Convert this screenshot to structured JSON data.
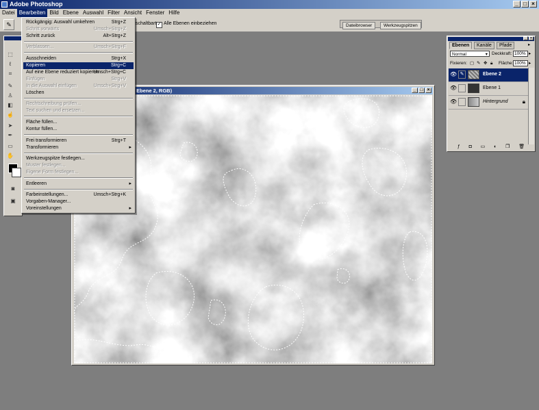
{
  "app": {
    "title": "Adobe Photoshop"
  },
  "menubar": [
    "Datei",
    "Bearbeiten",
    "Bild",
    "Ebene",
    "Auswahl",
    "Filter",
    "Ansicht",
    "Fenster",
    "Hilfe"
  ],
  "options_bar": {
    "partial_text": "schaltbart",
    "all_layers_label": "Alle Ebenen einbeziehen",
    "palette_tabs": [
      "Dateibrowser",
      "Werkzeugspitzen"
    ]
  },
  "edit_menu": [
    {
      "label": "Rückgängig: Auswahl umkehren",
      "shortcut": "Strg+Z",
      "state": "enabled"
    },
    {
      "label": "Schritt vorwärts",
      "shortcut": "Umsch+Strg+Z",
      "state": "disabled"
    },
    {
      "label": "Schritt zurück",
      "shortcut": "Alt+Strg+Z",
      "state": "enabled"
    },
    {
      "sep": true
    },
    {
      "label": "Verblassen...",
      "shortcut": "Umsch+Strg+F",
      "state": "disabled"
    },
    {
      "sep": true
    },
    {
      "label": "Ausschneiden",
      "shortcut": "Strg+X",
      "state": "enabled"
    },
    {
      "label": "Kopieren",
      "shortcut": "Strg+C",
      "state": "selected"
    },
    {
      "label": "Auf eine Ebene reduziert kopieren",
      "shortcut": "Umsch+Strg+C",
      "state": "enabled"
    },
    {
      "label": "Einfügen",
      "shortcut": "Strg+V",
      "state": "disabled"
    },
    {
      "label": "In die Auswahl einfügen",
      "shortcut": "Umsch+Strg+V",
      "state": "disabled"
    },
    {
      "label": "Löschen",
      "shortcut": "",
      "state": "enabled"
    },
    {
      "sep": true
    },
    {
      "label": "Rechtschreibung prüfen...",
      "shortcut": "",
      "state": "disabled"
    },
    {
      "label": "Text suchen und ersetzen...",
      "shortcut": "",
      "state": "disabled"
    },
    {
      "sep": true
    },
    {
      "label": "Fläche füllen...",
      "shortcut": "",
      "state": "enabled"
    },
    {
      "label": "Kontur füllen...",
      "shortcut": "",
      "state": "enabled"
    },
    {
      "sep": true
    },
    {
      "label": "Frei transformieren",
      "shortcut": "Strg+T",
      "state": "enabled"
    },
    {
      "label": "Transformieren",
      "shortcut": "",
      "state": "enabled",
      "submenu": true
    },
    {
      "sep": true
    },
    {
      "label": "Werkzeugspitze festlegen...",
      "shortcut": "",
      "state": "enabled"
    },
    {
      "label": "Muster festlegen...",
      "shortcut": "",
      "state": "disabled"
    },
    {
      "label": "Eigene Form festlegen...",
      "shortcut": "",
      "state": "disabled"
    },
    {
      "sep": true
    },
    {
      "label": "Entleeren",
      "shortcut": "",
      "state": "enabled",
      "submenu": true
    },
    {
      "sep": true
    },
    {
      "label": "Farbeinstellungen...",
      "shortcut": "Umsch+Strg+K",
      "state": "enabled"
    },
    {
      "label": "Vorgaben-Manager...",
      "shortcut": "",
      "state": "enabled"
    },
    {
      "label": "Voreinstellungen",
      "shortcut": "",
      "state": "enabled",
      "submenu": true
    }
  ],
  "document": {
    "title": "Ebene 2, RGB)"
  },
  "layers_palette": {
    "tabs": [
      "Ebenen",
      "Kanäle",
      "Pfade"
    ],
    "blend_mode": "Normal",
    "opacity_label": "Deckkraft:",
    "opacity_value": "100%",
    "lock_label": "Fixieren:",
    "fill_label": "Fläche:",
    "fill_value": "100%",
    "layers": [
      {
        "name": "Ebene 2",
        "selected": true
      },
      {
        "name": "Ebene 1",
        "selected": false
      },
      {
        "name": "Hintergrund",
        "selected": false,
        "locked": true
      }
    ]
  },
  "colors": {
    "accent": "#0a246a",
    "chrome": "#d4d0c8",
    "workspace": "#7e7e7e"
  }
}
